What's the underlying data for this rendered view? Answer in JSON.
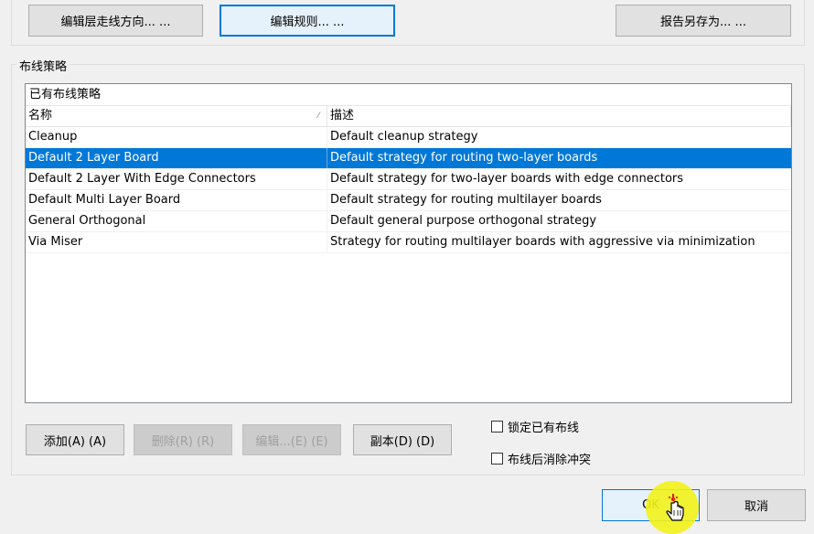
{
  "top_buttons": {
    "edit_layer_direction": "编辑层走线方向... ...",
    "edit_rules": "编辑规则... ...",
    "report_save_as": "报告另存为... ..."
  },
  "strategy_group": {
    "title": "布线策略",
    "list_caption": "已有布线策略",
    "columns": {
      "name": "名称",
      "description": "描述"
    },
    "rows": [
      {
        "name": "Cleanup",
        "description": "Default cleanup strategy"
      },
      {
        "name": "Default 2 Layer Board",
        "description": "Default strategy for routing two-layer boards"
      },
      {
        "name": "Default 2 Layer With Edge Connectors",
        "description": "Default strategy for two-layer boards with edge connectors"
      },
      {
        "name": "Default Multi Layer Board",
        "description": "Default strategy for routing multilayer boards"
      },
      {
        "name": "General Orthogonal",
        "description": "Default general purpose orthogonal strategy"
      },
      {
        "name": "Via Miser",
        "description": "Strategy for routing multilayer boards with aggressive via minimization"
      }
    ],
    "selected_row": "Default 2 Layer Board",
    "buttons": {
      "add": "添加(A) (A)",
      "delete": "删除(R) (R)",
      "edit": "编辑...(E) (E)",
      "copy": "副本(D) (D)"
    },
    "checkboxes": {
      "lock_existing": "锁定已有布线",
      "remove_conflicts": "布线后消除冲突"
    }
  },
  "dialog_buttons": {
    "ok": "OK",
    "cancel": "取消"
  },
  "colors": {
    "selection": "#0078d7",
    "cursor_highlight": "#f2f21a",
    "cursor_mark": "#e31b1b"
  },
  "icons": {
    "sort": "sort-indicator-icon",
    "pointer": "hand-pointer-icon"
  }
}
